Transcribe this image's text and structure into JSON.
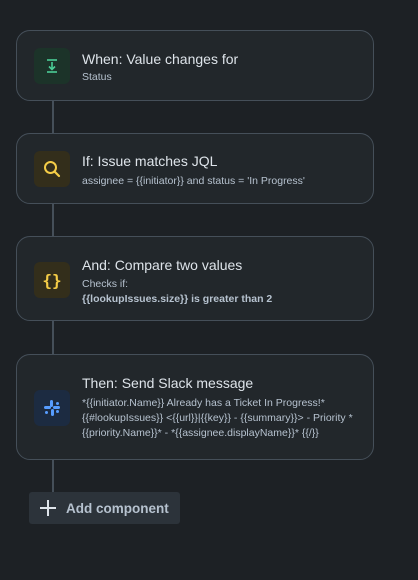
{
  "cards": [
    {
      "title": "When: Value changes for",
      "sub": "Status",
      "icon": "download-arrow-icon",
      "icon_color": "#4bce97",
      "icon_bg": "#1c3329"
    },
    {
      "title": "If: Issue matches JQL",
      "sub": "assignee = {{initiator}} and status = 'In Progress'",
      "icon": "search-icon",
      "icon_color": "#f5cd47",
      "icon_bg": "#332e1b"
    },
    {
      "title": "And: Compare two values",
      "sub": "Checks if:",
      "sub_bold": "{{lookupIssues.size}} is greater than 2",
      "icon": "curly-braces-icon",
      "icon_color": "#f5cd47",
      "icon_bg": "#332e1b"
    },
    {
      "title": "Then: Send Slack message",
      "sub": "*{{initiator.Name}} Already has a Ticket In Progress!* {{#lookupIssues}} <{{url}}|{{key}} - {{summary}}> - Priority *{{priority.Name}}* - *{{assignee.displayName}}* {{/}}",
      "icon": "slack-icon",
      "icon_color": "#579dff",
      "icon_bg": "#1c2b41"
    }
  ],
  "add_component": {
    "label": "Add component",
    "icon": "plus-icon"
  }
}
